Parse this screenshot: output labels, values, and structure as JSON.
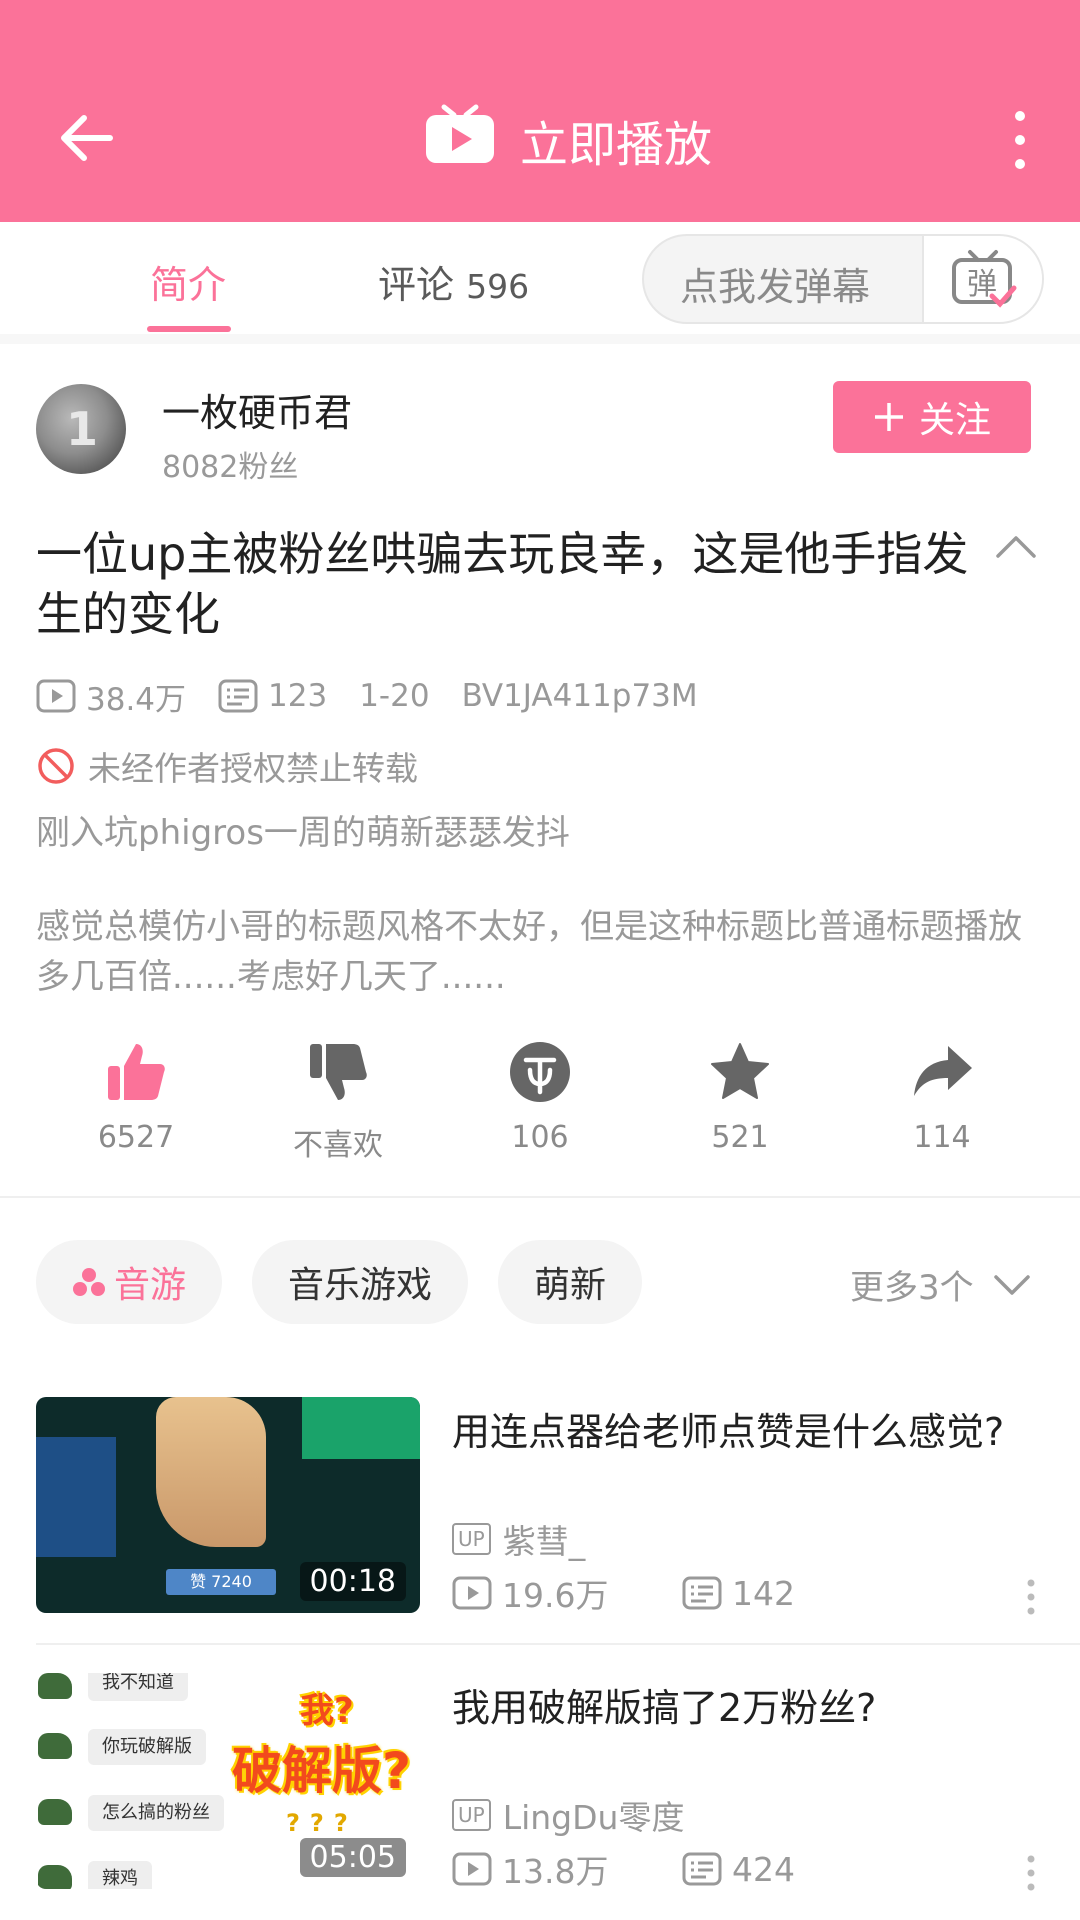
{
  "header": {
    "title": "立即播放",
    "bg_color": "#fb7299"
  },
  "tabs": [
    {
      "label": "简介"
    },
    {
      "label": "评论",
      "count": "596"
    }
  ],
  "danmaku": {
    "placeholder": "点我发弹幕",
    "icon_glyph": "弹"
  },
  "author": {
    "name": "一枚硬币君",
    "fans": "8082粉丝",
    "follow_label": "关注",
    "avatar_glyph": "1"
  },
  "video": {
    "title": "一位up主被粉丝哄骗去玩良幸，这是他手指发生的变化",
    "views": "38.4万",
    "danmaku_count": "123",
    "date": "1-20",
    "bvid": "BV1JA411p73M",
    "copyright_notice": "未经作者授权禁止转载",
    "desc_line1": "刚入坑phigros一周的萌新瑟瑟发抖",
    "desc_line2": "感觉总模仿小哥的标题风格不太好，但是这种标题比普通标题播放多几百倍......考虑好几天了......"
  },
  "actions": {
    "like": "6527",
    "dislike": "不喜欢",
    "coin": "106",
    "favorite": "521",
    "share": "114"
  },
  "tags": [
    {
      "label": "音游",
      "highlight": true
    },
    {
      "label": "音乐游戏"
    },
    {
      "label": "萌新"
    }
  ],
  "more_tags": "更多3个",
  "related": [
    {
      "title": "用连点器给老师点赞是什么感觉?",
      "up_badge": "UP",
      "uploader": "紫彗_",
      "views": "19.6万",
      "danmaku": "142",
      "duration": "00:18",
      "thumb_text": "赞 7240"
    },
    {
      "title": "我用破解版搞了2万粉丝?",
      "up_badge": "UP",
      "uploader": "LingDu零度",
      "views": "13.8万",
      "danmaku": "424",
      "duration": "05:05",
      "thumb_chats": [
        "我不知道",
        "你玩破解版",
        "怎么搞的粉丝",
        "辣鸡"
      ],
      "thumb_big": "破解版?",
      "thumb_small": "我?",
      "thumb_q": "???"
    }
  ]
}
